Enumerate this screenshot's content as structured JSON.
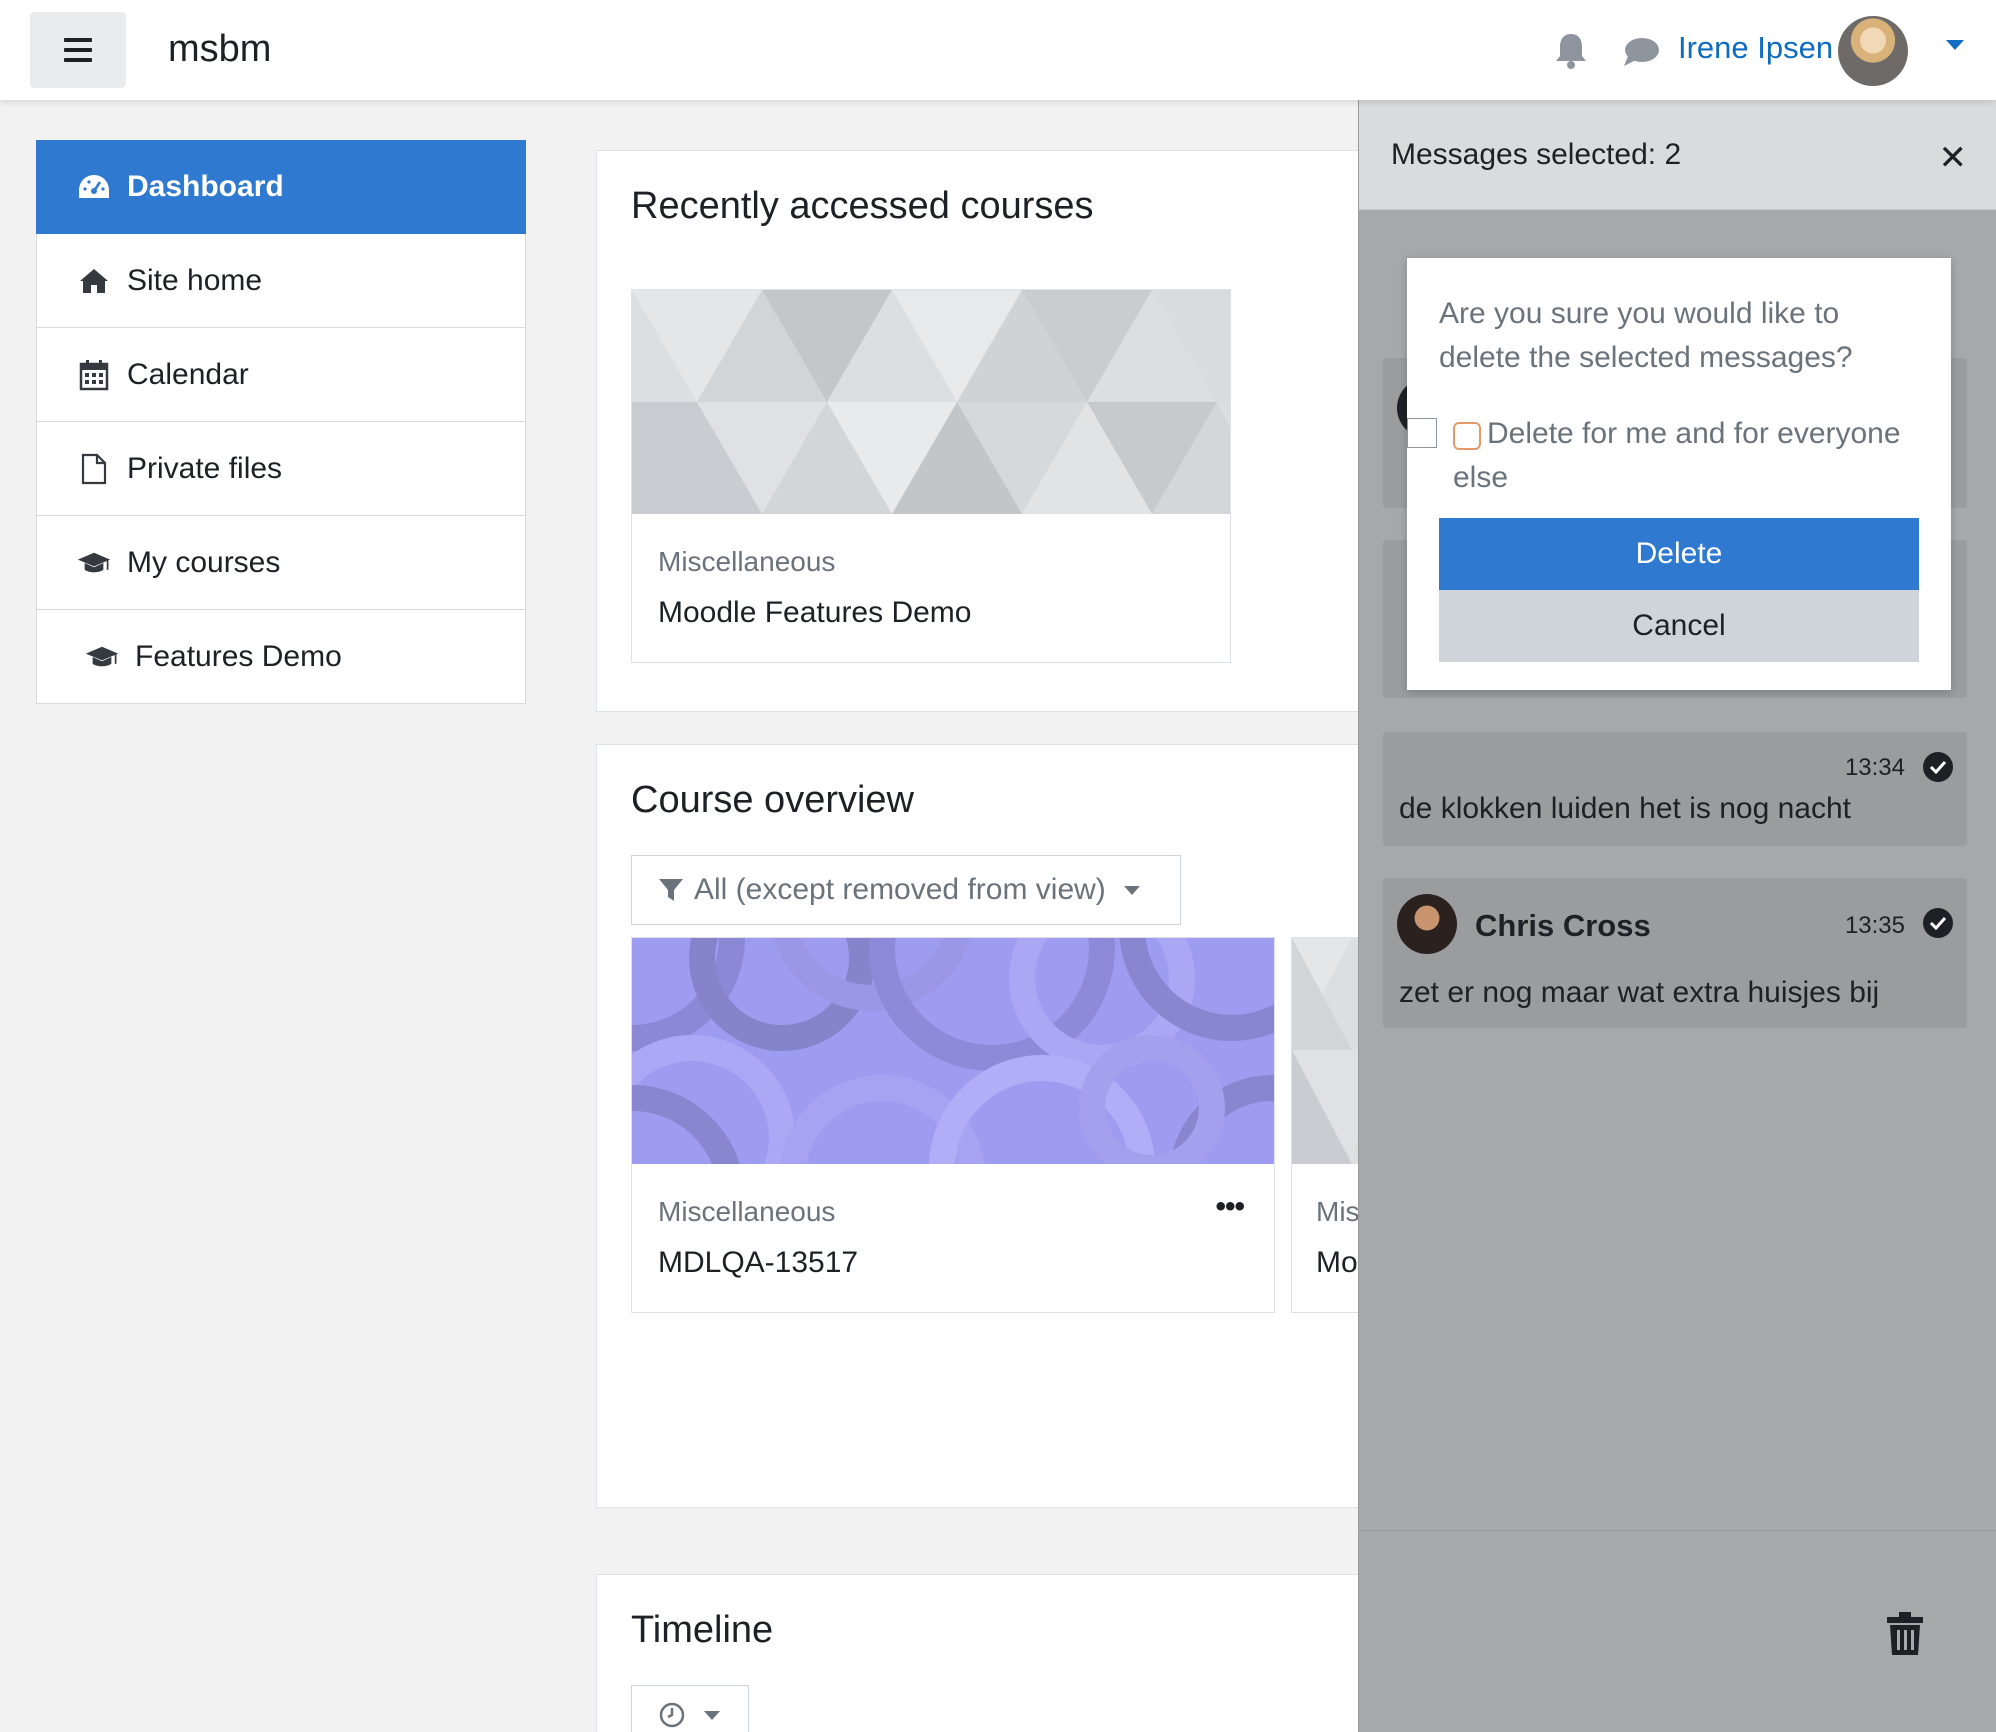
{
  "navbar": {
    "site_name": "msbm",
    "user_name": "Irene Ipsen",
    "icons": [
      "menu-icon",
      "bell-icon",
      "chat-icon",
      "caret-down-icon"
    ]
  },
  "sidebar": {
    "items": [
      {
        "label": "Dashboard",
        "icon": "dashboard-icon",
        "active": true
      },
      {
        "label": "Site home",
        "icon": "home-icon"
      },
      {
        "label": "Calendar",
        "icon": "calendar-icon"
      },
      {
        "label": "Private files",
        "icon": "file-icon"
      },
      {
        "label": "My courses",
        "icon": "graduation-cap-icon"
      },
      {
        "label": "Features Demo",
        "icon": "graduation-cap-icon"
      }
    ]
  },
  "main": {
    "recent": {
      "title": "Recently accessed courses",
      "course": {
        "category": "Miscellaneous",
        "name": "Moodle Features Demo"
      }
    },
    "overview": {
      "title": "Course overview",
      "filter_label": "All (except removed from view)",
      "courses": [
        {
          "category": "Miscellaneous",
          "name": "MDLQA-13517"
        },
        {
          "category": "Mis",
          "name": "Mo"
        }
      ]
    },
    "timeline": {
      "title": "Timeline"
    }
  },
  "messages": {
    "header": "Messages selected: 2",
    "dialog": {
      "question": "Are you sure you would like to delete the selected messages?",
      "option": "Delete for me and for everyone else",
      "delete_label": "Delete",
      "cancel_label": "Cancel"
    },
    "bubbles": [
      {
        "time": "13:34",
        "text": "de klokken luiden het is nog nacht"
      },
      {
        "sender": "Chris Cross",
        "time": "13:35",
        "text": "zet er nog maar wat extra huisjes bij"
      }
    ]
  },
  "colors": {
    "primary": "#2f7ad0",
    "link": "#0f6cbf",
    "drawer_bg": "#a7a8a9"
  }
}
